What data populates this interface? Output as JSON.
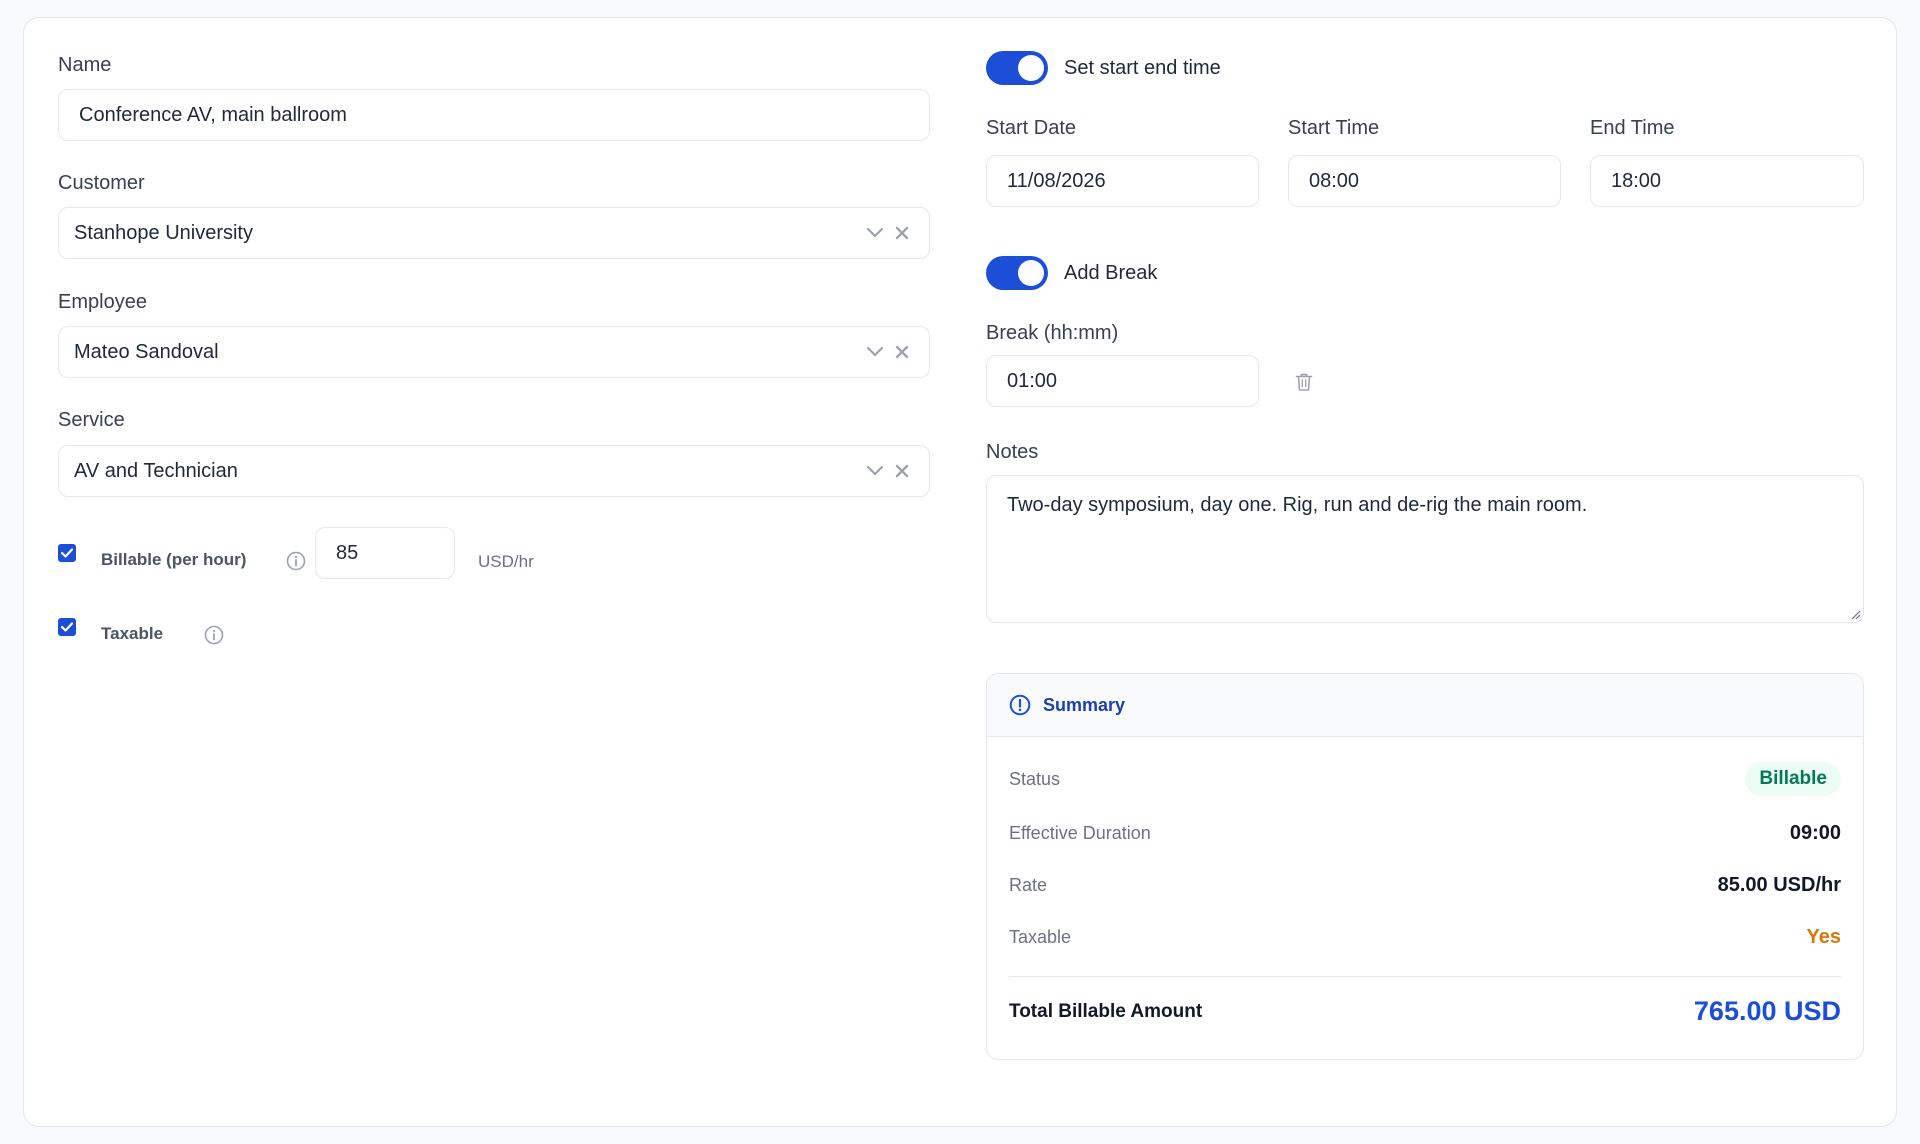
{
  "form": {
    "name": {
      "label": "Name",
      "value": "Conference AV, main ballroom"
    },
    "customer": {
      "label": "Customer",
      "value": "Stanhope University"
    },
    "employee": {
      "label": "Employee",
      "value": "Mateo Sandoval"
    },
    "service": {
      "label": "Service",
      "value": "AV and Technician"
    },
    "billable": {
      "label": "Billable (per hour)",
      "checked": true,
      "rate": "85",
      "unit": "USD/hr"
    },
    "taxable": {
      "label": "Taxable",
      "checked": true
    }
  },
  "schedule": {
    "toggle_label": "Set start end time",
    "enabled": true,
    "start_date": {
      "label": "Start Date",
      "value": "11/08/2026"
    },
    "start_time": {
      "label": "Start Time",
      "value": "08:00"
    },
    "end_time": {
      "label": "End Time",
      "value": "18:00"
    }
  },
  "break": {
    "toggle_label": "Add Break",
    "enabled": true,
    "label": "Break (hh:mm)",
    "value": "01:00"
  },
  "notes": {
    "label": "Notes",
    "value": "Two-day symposium, day one. Rig, run and de-rig the main room."
  },
  "summary": {
    "title": "Summary",
    "status_label": "Status",
    "status_value": "Billable",
    "duration_label": "Effective Duration",
    "duration_value": "09:00",
    "rate_label": "Rate",
    "rate_value": "85.00 USD/hr",
    "taxable_label": "Taxable",
    "taxable_value": "Yes",
    "total_label": "Total Billable Amount",
    "total_value": "765.00 USD"
  },
  "colors": {
    "accent": "#1d4ed8",
    "status_green": "#047857",
    "taxable_orange": "#d97706"
  },
  "icons": [
    "chevron-down-icon",
    "clear-icon",
    "info-icon",
    "trash-icon",
    "alert-circle-icon",
    "check-icon"
  ]
}
